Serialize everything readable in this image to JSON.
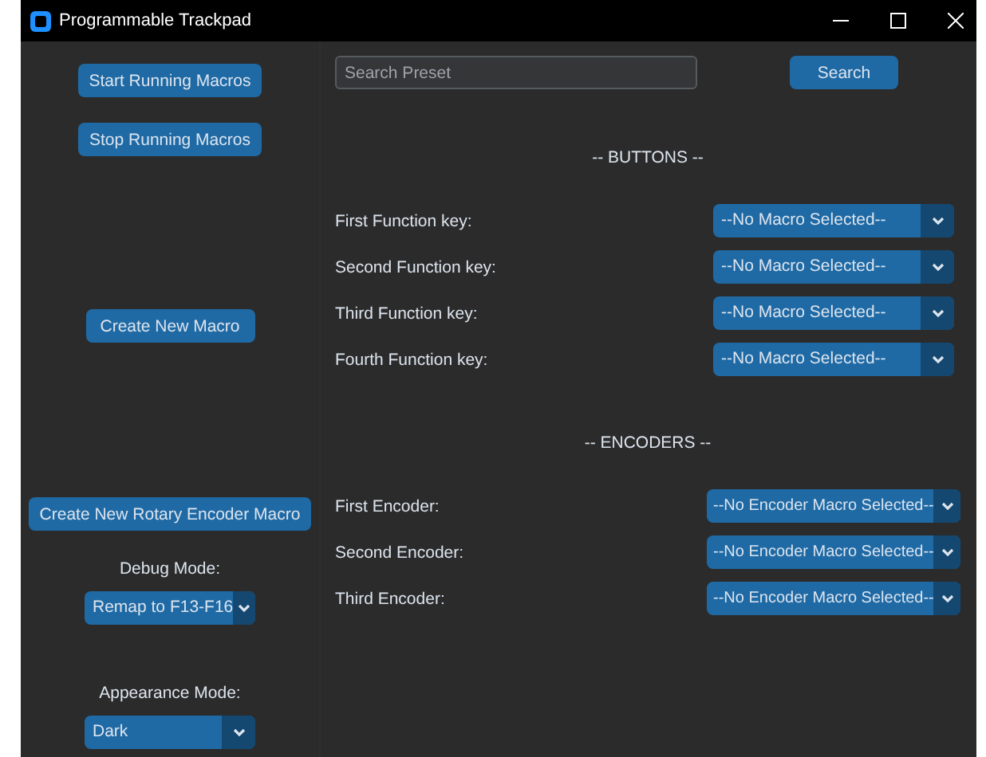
{
  "window": {
    "title": "Programmable Trackpad"
  },
  "sidebar": {
    "buttons": [
      "Start Running Macros",
      "Stop Running Macros",
      "Create New Macro",
      "Create New Rotary Encoder Macro"
    ],
    "debug_mode": {
      "label": "Debug Mode:",
      "value": "Remap to F13-F16"
    },
    "appearance_mode": {
      "label": "Appearance Mode:",
      "value": "Dark"
    }
  },
  "search": {
    "placeholder": "Search Preset",
    "button": "Search"
  },
  "sections": [
    {
      "heading": "-- BUTTONS --",
      "rows": [
        {
          "label": "First Function key:",
          "value": "--No Macro Selected--"
        },
        {
          "label": "Second Function key:",
          "value": "--No Macro Selected--"
        },
        {
          "label": "Third Function key:",
          "value": "--No Macro Selected--"
        },
        {
          "label": "Fourth Function key:",
          "value": "--No Macro Selected--"
        }
      ]
    },
    {
      "heading": "-- ENCODERS --",
      "rows": [
        {
          "label": "First Encoder:",
          "value": "--No Encoder Macro Selected--"
        },
        {
          "label": "Second Encoder:",
          "value": "--No Encoder Macro Selected--"
        },
        {
          "label": "Third Encoder:",
          "value": "--No Encoder Macro Selected--"
        }
      ]
    }
  ]
}
